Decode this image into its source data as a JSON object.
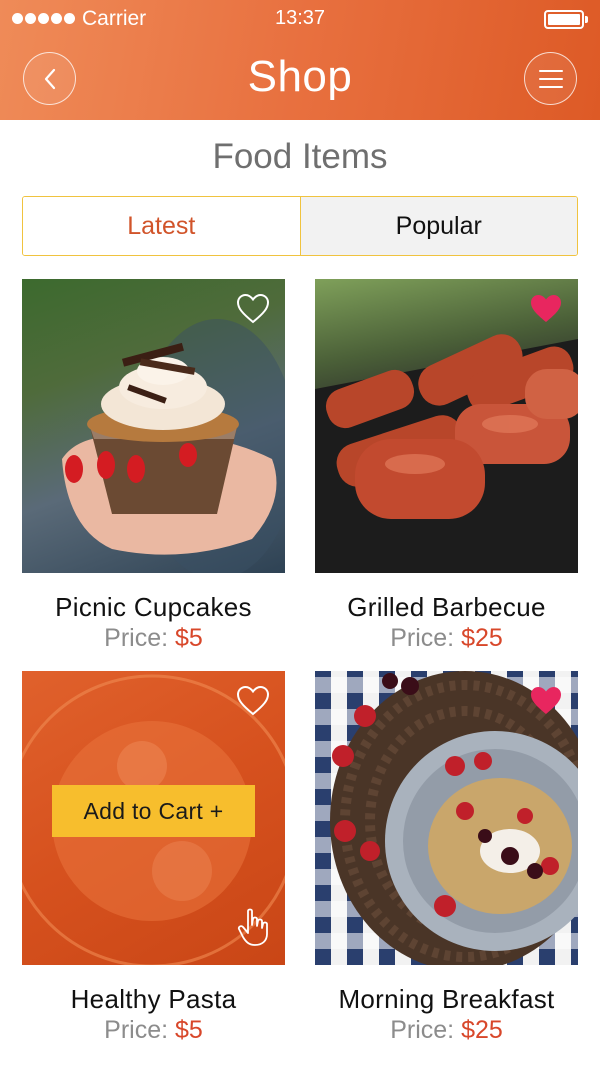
{
  "status_bar": {
    "carrier": "Carrier",
    "time": "13:37"
  },
  "header": {
    "title": "Shop",
    "back_icon": "chevron-left-icon",
    "menu_icon": "hamburger-menu-icon"
  },
  "section_title": "Food Items",
  "tabs": [
    {
      "label": "Latest",
      "active": true
    },
    {
      "label": "Popular",
      "active": false
    }
  ],
  "products": [
    {
      "name": "Picnic Cupcakes",
      "price_label": "Price:",
      "price_value": "$5",
      "favorited": false
    },
    {
      "name": "Grilled Barbecue",
      "price_label": "Price:",
      "price_value": "$25",
      "favorited": true
    },
    {
      "name": "Healthy Pasta",
      "price_label": "Price:",
      "price_value": "$5",
      "favorited": false,
      "overlay_button": "Add to Cart +"
    },
    {
      "name": "Morning Breakfast",
      "price_label": "Price:",
      "price_value": "$25",
      "favorited": true
    }
  ],
  "colors": {
    "header_gradient_start": "#ef8b58",
    "header_gradient_end": "#dd5a26",
    "accent": "#d1542a",
    "price": "#d8472a",
    "tab_border": "#f0c33f",
    "cart_button": "#f7be2d",
    "heart_filled": "#e8265f"
  }
}
